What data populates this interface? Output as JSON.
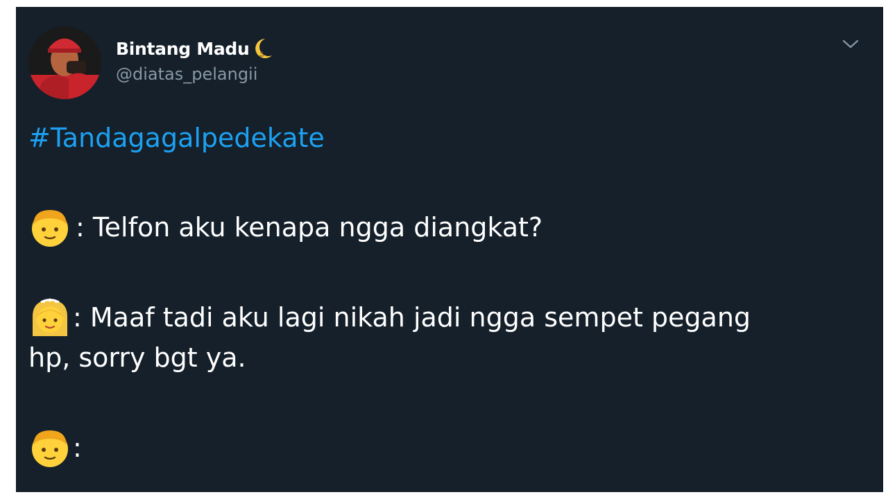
{
  "tweet": {
    "display_name": "Bintang Madu",
    "name_emoji": "crescent-moon-icon",
    "handle": "@diatas_pelangii",
    "hashtag": "#Tandagagalpedekate",
    "lines": {
      "line1": ": Telfon aku kenapa ngga diangkat?",
      "line2": ": Maaf tadi aku lagi nikah jadi ngga sempet pegang",
      "line3": "hp, sorry bgt ya.",
      "line4": ":"
    },
    "emojis": {
      "line1": "boy-emoji",
      "line2": "bride-emoji",
      "line4": "boy-emoji"
    }
  },
  "colors": {
    "background": "#15202b",
    "hashtag": "#1da1f2",
    "handle": "#8899a6",
    "text": "#ffffff"
  }
}
